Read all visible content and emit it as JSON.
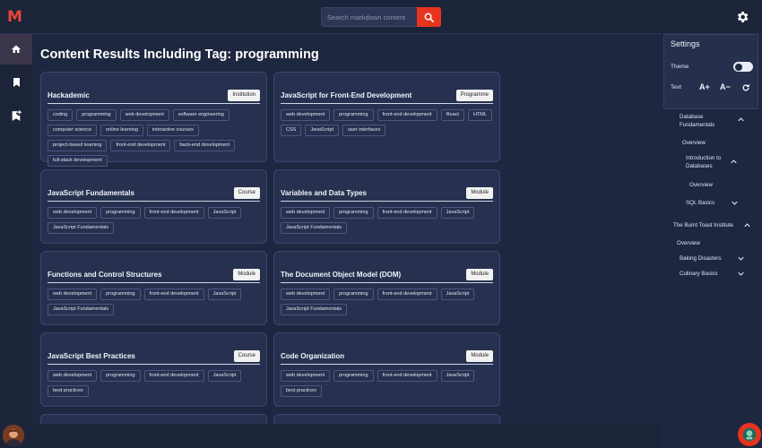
{
  "app": {
    "logo": "M"
  },
  "search": {
    "placeholder": "Search markdown content"
  },
  "page": {
    "title": "Content Results Including Tag: programming"
  },
  "cards": [
    {
      "title": "Hackademic",
      "badge": "Institution",
      "tags": [
        "coding",
        "programming",
        "web development",
        "software engineering",
        "computer science",
        "online learning",
        "interactive courses",
        "project-based learning",
        "front-end development",
        "back-end development",
        "full-stack development"
      ]
    },
    {
      "title": "JavaScript for Front-End Development",
      "badge": "Programme",
      "tags": [
        "web development",
        "programming",
        "front-end development",
        "React",
        "HTML",
        "CSS",
        "JavaScript",
        "user interfaces"
      ]
    },
    {
      "title": "JavaScript Fundamentals",
      "badge": "Course",
      "tags": [
        "web development",
        "programming",
        "front-end development",
        "JavaScript",
        "JavaScript Fundamentals"
      ]
    },
    {
      "title": "Variables and Data Types",
      "badge": "Module",
      "tags": [
        "web development",
        "programming",
        "front-end development",
        "JavaScript",
        "JavaScript Fundamentals"
      ]
    },
    {
      "title": "Functions and Control Structures",
      "badge": "Module",
      "tags": [
        "web development",
        "programming",
        "front-end development",
        "JavaScript",
        "JavaScript Fundamentals"
      ]
    },
    {
      "title": "The Document Object Model (DOM)",
      "badge": "Module",
      "tags": [
        "web development",
        "programming",
        "front-end development",
        "JavaScript",
        "JavaScript Fundamentals"
      ]
    },
    {
      "title": "JavaScript Best Practices",
      "badge": "Course",
      "tags": [
        "web development",
        "programming",
        "front-end development",
        "JavaScript",
        "best practices"
      ]
    },
    {
      "title": "Code Organization",
      "badge": "Module",
      "tags": [
        "web development",
        "programming",
        "front-end development",
        "JavaScript",
        "best practices"
      ]
    }
  ],
  "settings": {
    "title": "Settings",
    "theme_label": "Theme",
    "text_label": "Text",
    "increase": "A+",
    "decrease": "A−"
  },
  "tree": [
    {
      "label": "Database Fundamentals",
      "chevron": "up"
    },
    {
      "label": "Overview"
    },
    {
      "label": "Introduction to Databases",
      "chevron": "up"
    },
    {
      "label": "Overview"
    },
    {
      "label": "SQL Basics",
      "chevron": "down"
    },
    {
      "label": "The Burnt Toast Institute",
      "chevron": "up"
    },
    {
      "label": "Overview"
    },
    {
      "label": "Baking Disasters",
      "chevron": "down"
    },
    {
      "label": "Culinary Basics",
      "chevron": "down"
    }
  ],
  "icons": [
    "home-icon",
    "bookmark-icon",
    "bookmark-add-icon",
    "search-icon",
    "gear-icon",
    "refresh-icon",
    "theme-toggle-icon",
    "chevron-up-icon",
    "chevron-down-icon"
  ],
  "colors": {
    "accent": "#e8341f",
    "background": "#1e2740",
    "card": "#27314f"
  }
}
